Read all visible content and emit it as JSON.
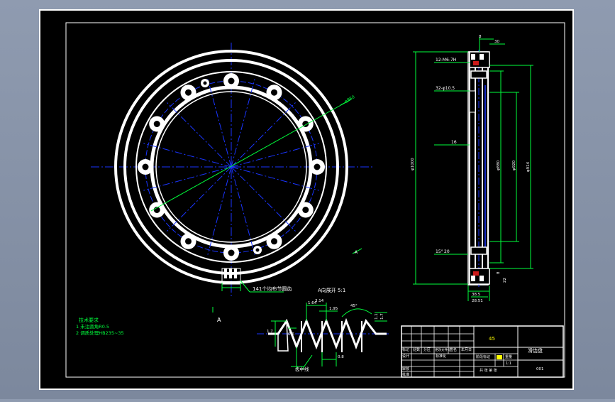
{
  "viewport": {
    "background": "#7e8a9f",
    "sheet_color": "#000000"
  },
  "front_view": {
    "pitch_line_label": "φ980",
    "section_label": "A",
    "teeth_note": "141个均布节圆齿",
    "section_tag": "A"
  },
  "side_view": {
    "dims": {
      "top_width": "8",
      "top_right": "30",
      "holes_1": "12-M6-7H",
      "holes_2": "32-φ10.5",
      "hub": "16",
      "total_dia": "φ1000",
      "d1": "φ914",
      "d2": "φ920",
      "d3": "φ880",
      "bottom_1": "8",
      "bottom_2": "22",
      "width_total": "38.5",
      "bottom_3": "28.51",
      "tilt": "15°",
      "left_marker": "20"
    }
  },
  "tooth_detail": {
    "title": "A向展开  5:1",
    "dims": {
      "top_left": "1.64",
      "pitch": "3.14",
      "width": "1.95",
      "angle": "45°",
      "height": "1.7",
      "right_height": "1.1",
      "bottom": "0.8",
      "left_height": "1.7",
      "half": "0.6"
    },
    "pitch_line_note": "齿中线"
  },
  "tech_notes": {
    "title": "技术要求",
    "items": [
      "1 未注圆角R0.5",
      "2 调质处理HB235~35"
    ]
  },
  "title_block": {
    "material": "45",
    "part_name": "滑齿盘",
    "drawing_no": "001",
    "row_labels": {
      "mark": "标记",
      "design": "设计",
      "check": "审核",
      "approve": "批准"
    },
    "header_cells": [
      "处数",
      "分区",
      "更改文件号",
      "签名",
      "年月日"
    ],
    "std_labels": {
      "std": "标准化",
      "stage": "阶段标记",
      "weight": "重量",
      "scale": "比例"
    },
    "scale_value": "1:1",
    "sheet_info": "共 张  第 张"
  },
  "colors": {
    "white": "#ffffff",
    "blue": "#1a35ff",
    "green": "#00ff3c",
    "yellow": "#ffff00",
    "cyan": "#00ffff",
    "accent": "#ff2020",
    "frame": "#ffffff"
  }
}
